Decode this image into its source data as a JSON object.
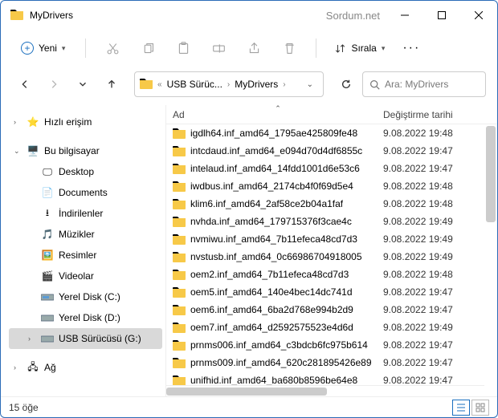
{
  "window": {
    "title": "MyDrivers",
    "watermark": "Sordum.net"
  },
  "toolbar": {
    "new_label": "Yeni",
    "sort_label": "Sırala"
  },
  "breadcrumb": {
    "seg1": "USB Sürüc...",
    "seg2": "MyDrivers"
  },
  "search": {
    "placeholder": "Ara: MyDrivers"
  },
  "columns": {
    "name": "Ad",
    "date": "Değiştirme tarihi"
  },
  "tree": {
    "quick": "Hızlı erişim",
    "thispc": "Bu bilgisayar",
    "desktop": "Desktop",
    "documents": "Documents",
    "downloads": "İndirilenler",
    "music": "Müzikler",
    "pictures": "Resimler",
    "videos": "Videolar",
    "diskc": "Yerel Disk (C:)",
    "diskd": "Yerel Disk (D:)",
    "usbg": "USB Sürücüsü (G:)",
    "network": "Ağ"
  },
  "files": [
    {
      "name": "igdlh64.inf_amd64_1795ae425809fe48",
      "date": "9.08.2022 19:48"
    },
    {
      "name": "intcdaud.inf_amd64_e094d70d4df6855c",
      "date": "9.08.2022 19:47"
    },
    {
      "name": "intelaud.inf_amd64_14fdd1001d6e53c6",
      "date": "9.08.2022 19:47"
    },
    {
      "name": "iwdbus.inf_amd64_2174cb4f0f69d5e4",
      "date": "9.08.2022 19:48"
    },
    {
      "name": "klim6.inf_amd64_2af58ce2b04a1faf",
      "date": "9.08.2022 19:48"
    },
    {
      "name": "nvhda.inf_amd64_179715376f3cae4c",
      "date": "9.08.2022 19:49"
    },
    {
      "name": "nvmiwu.inf_amd64_7b11efeca48cd7d3",
      "date": "9.08.2022 19:49"
    },
    {
      "name": "nvstusb.inf_amd64_0c66986704918005",
      "date": "9.08.2022 19:49"
    },
    {
      "name": "oem2.inf_amd64_7b11efeca48cd7d3",
      "date": "9.08.2022 19:48"
    },
    {
      "name": "oem5.inf_amd64_140e4bec14dc741d",
      "date": "9.08.2022 19:47"
    },
    {
      "name": "oem6.inf_amd64_6ba2d768e994b2d9",
      "date": "9.08.2022 19:47"
    },
    {
      "name": "oem7.inf_amd64_d2592575523e4d6d",
      "date": "9.08.2022 19:49"
    },
    {
      "name": "prnms006.inf_amd64_c3bdcb6fc975b614",
      "date": "9.08.2022 19:47"
    },
    {
      "name": "prnms009.inf_amd64_620c281895426e89",
      "date": "9.08.2022 19:47"
    },
    {
      "name": "unifhid.inf_amd64_ba680b8596be64e8",
      "date": "9.08.2022 19:47"
    }
  ],
  "status": {
    "count": "15 öğe"
  }
}
